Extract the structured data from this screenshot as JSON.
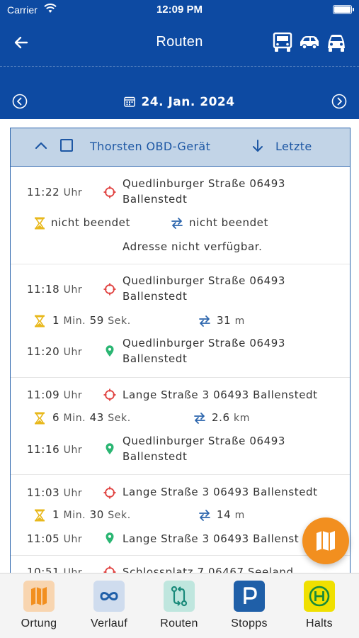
{
  "status_bar": {
    "carrier": "Carrier",
    "time": "12:09 PM"
  },
  "header": {
    "title": "Routen",
    "date": "24. Jan. 2024",
    "vehicle_icons": [
      "truck-icon",
      "car-icon",
      "car-front-icon"
    ]
  },
  "list_header": {
    "device": "Thorsten OBD-Gerät",
    "sort_label": "Letzte"
  },
  "routes": [
    {
      "start_time": "11:22",
      "start_unit": "Uhr",
      "start_addr_1": "Quedlinburger Straße 06493",
      "start_addr_2": "Ballenstedt",
      "duration": "nicht beendet",
      "distance": "nicht beendet",
      "end_note": "Adresse nicht verfügbar."
    },
    {
      "start_time": "11:18",
      "start_unit": "Uhr",
      "start_addr_1": "Quedlinburger Straße 06493",
      "start_addr_2": "Ballenstedt",
      "dur_min": "1",
      "dur_min_unit": "Min.",
      "dur_sec": "59",
      "dur_sec_unit": "Sek.",
      "dist_val": "31",
      "dist_unit": "m",
      "end_time": "11:20",
      "end_unit": "Uhr",
      "end_addr_1": "Quedlinburger Straße 06493",
      "end_addr_2": "Ballenstedt"
    },
    {
      "start_time": "11:09",
      "start_unit": "Uhr",
      "start_addr_1": "Lange Straße 3 06493 Ballenstedt",
      "dur_min": "6",
      "dur_min_unit": "Min.",
      "dur_sec": "43",
      "dur_sec_unit": "Sek.",
      "dist_val": "2.6",
      "dist_unit": "km",
      "end_time": "11:16",
      "end_unit": "Uhr",
      "end_addr_1": "Quedlinburger Straße 06493",
      "end_addr_2": "Ballenstedt"
    },
    {
      "start_time": "11:03",
      "start_unit": "Uhr",
      "start_addr_1": "Lange Straße 3 06493 Ballenstedt",
      "dur_min": "1",
      "dur_min_unit": "Min.",
      "dur_sec": "30",
      "dur_sec_unit": "Sek.",
      "dist_val": "14",
      "dist_unit": "m",
      "end_time": "11:05",
      "end_unit": "Uhr",
      "end_addr_1": "Lange Straße 3 06493 Ballenst"
    },
    {
      "start_time": "10:51",
      "start_unit": "Uhr",
      "start_addr_1": "Schlossplatz 7 06467 Seeland"
    }
  ],
  "tabs": [
    {
      "label": "Ortung",
      "icon": "map-icon",
      "color": "#f5c89a"
    },
    {
      "label": "Verlauf",
      "icon": "infinity-icon",
      "color": "#c9d8ec"
    },
    {
      "label": "Routen",
      "icon": "route-icon",
      "color": "#b7e3dc"
    },
    {
      "label": "Stopps",
      "icon": "parking-icon",
      "color": "#1f5fa8"
    },
    {
      "label": "Halts",
      "icon": "bus-stop-icon",
      "color": "#f0e000"
    }
  ],
  "colors": {
    "primary": "#0d4aa2",
    "accent": "#f28f1f",
    "start_pin": "#e0413f",
    "end_pin": "#2bb673",
    "hourglass": "#e8b81c",
    "switch": "#2d66ad"
  }
}
